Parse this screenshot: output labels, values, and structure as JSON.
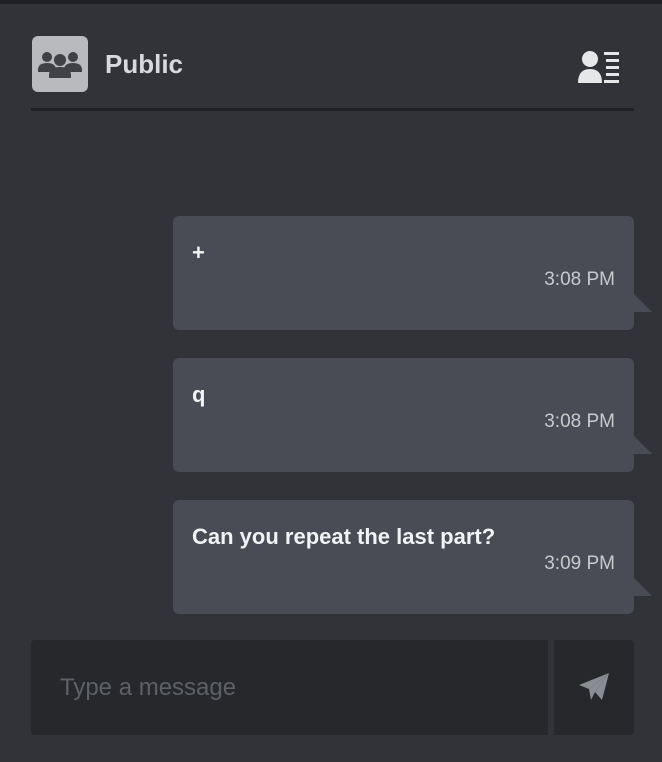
{
  "channel": {
    "name": "Public",
    "avatar_icon": "group-icon",
    "members_icon": "member-list-icon"
  },
  "messages": [
    {
      "text": "+",
      "time": "3:08 PM"
    },
    {
      "text": "q",
      "time": "3:08 PM"
    },
    {
      "text": "Can you repeat the last part?",
      "time": "3:09 PM"
    }
  ],
  "composer": {
    "placeholder": "Type a message",
    "value": "",
    "send_icon": "send-icon"
  },
  "colors": {
    "background": "#313338",
    "bubble": "#494c55",
    "input": "#26282c"
  }
}
